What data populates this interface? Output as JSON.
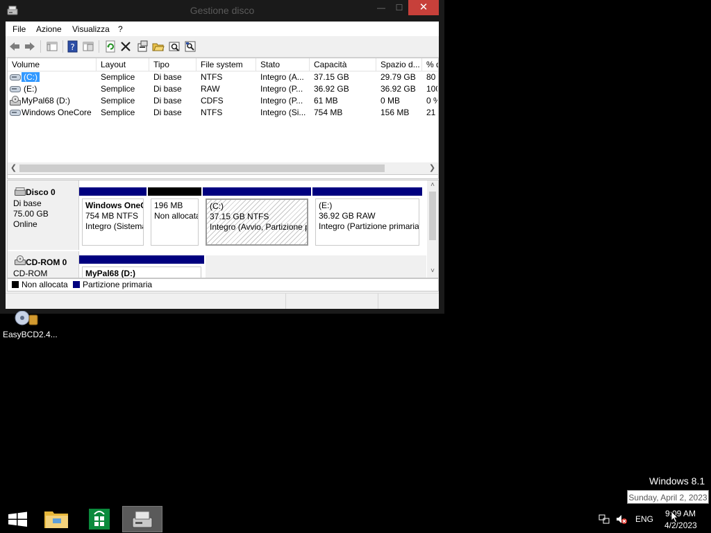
{
  "window": {
    "title": "Gestione disco",
    "min_glyph": "—",
    "max_glyph": "☐",
    "close_glyph": "✕"
  },
  "menu": [
    "File",
    "Azione",
    "Visualizza",
    "?"
  ],
  "toolbar_icons": [
    "back-icon",
    "forward-icon",
    "console-tree-icon",
    "help-icon",
    "properties-view-icon",
    "refresh-icon",
    "delete-icon",
    "properties-icon",
    "open-icon",
    "explore-icon",
    "rescan-icon"
  ],
  "volume_list": {
    "columns": [
      "Volume",
      "Layout",
      "Tipo",
      "File system",
      "Stato",
      "Capacità",
      "Spazio d...",
      "% d"
    ],
    "rows": [
      {
        "volume": "(C:)",
        "layout": "Semplice",
        "tipo": "Di base",
        "fs": "NTFS",
        "stato": "Integro (A...",
        "capacita": "37.15 GB",
        "spazio": "29.79 GB",
        "pct": "80",
        "selected": true,
        "icon": "disk-volume-icon"
      },
      {
        "volume": "(E:)",
        "layout": "Semplice",
        "tipo": "Di base",
        "fs": "RAW",
        "stato": "Integro (P...",
        "capacita": "36.92 GB",
        "spazio": "36.92 GB",
        "pct": "100",
        "selected": false,
        "icon": "disk-volume-icon"
      },
      {
        "volume": "MyPal68 (D:)",
        "layout": "Semplice",
        "tipo": "Di base",
        "fs": "CDFS",
        "stato": "Integro (P...",
        "capacita": "61 MB",
        "spazio": "0 MB",
        "pct": "0 %",
        "selected": false,
        "icon": "cdrom-volume-icon"
      },
      {
        "volume": "Windows OneCore",
        "layout": "Semplice",
        "tipo": "Di base",
        "fs": "NTFS",
        "stato": "Integro (Si...",
        "capacita": "754 MB",
        "spazio": "156 MB",
        "pct": "21",
        "selected": false,
        "icon": "disk-volume-icon"
      }
    ]
  },
  "disks": [
    {
      "name": "Disco 0",
      "type": "Di base",
      "size": "75.00 GB",
      "status": "Online",
      "partitions": [
        {
          "title": "Windows OneC",
          "line2": "754 MB NTFS",
          "line3": "Integro (Sistema",
          "kind": "primary"
        },
        {
          "title": "",
          "line2": "196 MB",
          "line3": "Non allocata",
          "kind": "unallocated"
        },
        {
          "title": "(C:)",
          "line2": "37.15 GB NTFS",
          "line3": "Integro (Avvio, Partizione p",
          "kind": "primary",
          "selected": true
        },
        {
          "title": "(E:)",
          "line2": "36.92 GB RAW",
          "line3": "Integro (Partizione primaria)",
          "kind": "primary"
        }
      ]
    },
    {
      "name": "CD-ROM 0",
      "type": "CD-ROM",
      "partitions": [
        {
          "title": "MyPal68  (D:)",
          "kind": "primary"
        }
      ]
    }
  ],
  "legend": [
    {
      "label": "Non allocata",
      "color": "#000000"
    },
    {
      "label": "Partizione primaria",
      "color": "#00007f"
    }
  ],
  "desktop": {
    "icon_label": "EasyBCD2.4...",
    "watermark": "Windows 8.1",
    "tooltip": "Sunday, April 2, 2023"
  },
  "taskbar": {
    "buttons": [
      "start-icon",
      "file-explorer-icon",
      "store-icon",
      "disk-management-icon"
    ],
    "lang": "ENG",
    "time": "9:09 AM",
    "date": "4/2/2023"
  },
  "colors": {
    "primary_bar": "#00007f",
    "unalloc_bar": "#000000",
    "selection": "#3399ff"
  }
}
